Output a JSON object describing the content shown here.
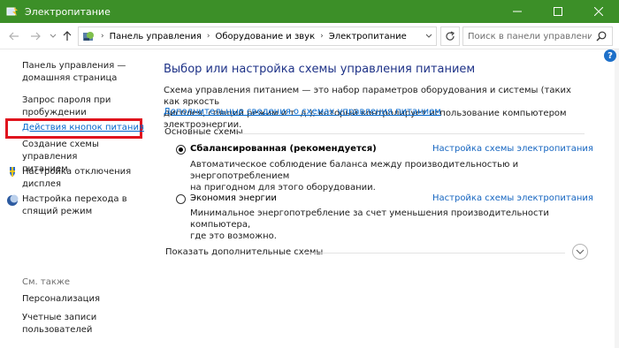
{
  "window": {
    "title": "Электропитание",
    "accent": "#3c8f28",
    "controls": {
      "minimize": "minimize-icon",
      "maximize": "maximize-icon",
      "close": "close-icon"
    }
  },
  "address": {
    "breadcrumbs": [
      "Панель управления",
      "Оборудование и звук",
      "Электропитание"
    ],
    "search_placeholder": "Поиск в панели управления"
  },
  "sidebar": {
    "home_line1": "Панель управления —",
    "home_line2": "домашняя страница",
    "items": [
      {
        "line1": "Запрос пароля при",
        "line2": "пробуждении"
      },
      {
        "line1": "Действия кнопок питания",
        "line2": "",
        "highlighted": true
      },
      {
        "line1": "Создание схемы управления",
        "line2": "питанием"
      },
      {
        "line1": "Настройка отключения",
        "line2": "дисплея"
      },
      {
        "line1": "Настройка перехода в",
        "line2": "спящий режим"
      }
    ],
    "see_also": "См. также",
    "see_also_items": [
      {
        "line1": "Персонализация",
        "line2": ""
      },
      {
        "line1": "Учетные записи",
        "line2": "пользователей"
      }
    ],
    "highlight_color": "#e0141e"
  },
  "main": {
    "heading": "Выбор или настройка схемы управления питанием",
    "description_line1": "Схема управления питанием — это набор параметров оборудования и системы (таких как яркость",
    "description_line2": "дисплея, спящий режим и т. д.), который контролирует использование компьютером электроэнергии.",
    "description_link": "Дополнительные сведения о схемах управления питанием",
    "section_label": "Основные схемы",
    "plans": [
      {
        "name": "Сбалансированная (рекомендуется)",
        "selected": true,
        "link": "Настройка схемы электропитания",
        "desc_line1": "Автоматическое соблюдение баланса между производительностью и энергопотреблением",
        "desc_line2": "на пригодном для этого оборудовании."
      },
      {
        "name": "Экономия энергии",
        "selected": false,
        "link": "Настройка схемы электропитания",
        "desc_line1": "Минимальное энергопотребление за счет уменьшения производительности компьютера,",
        "desc_line2": "где это возможно."
      }
    ],
    "more_plans": "Показать дополнительные схемы"
  },
  "help": "?"
}
